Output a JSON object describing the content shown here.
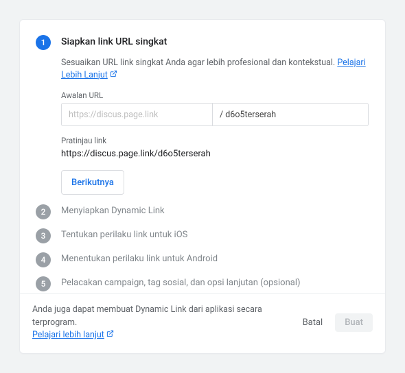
{
  "steps": {
    "s1": {
      "num": "1",
      "title": "Siapkan link URL singkat",
      "desc": "Sesuaikan URL link singkat Anda agar lebih profesional dan kontekstual.",
      "learn": "Pelajari Lebih Lanjut",
      "urlLabel": "Awalan URL",
      "urlPrefix": "https://discus.page.link",
      "urlSuffix": "/ d6o5terserah",
      "previewLabel": "Pratinjau link",
      "previewValue": "https://discus.page.link/d6o5terserah",
      "next": "Berikutnya"
    },
    "s2": {
      "num": "2",
      "title": "Menyiapkan Dynamic Link"
    },
    "s3": {
      "num": "3",
      "title": "Tentukan perilaku link untuk iOS"
    },
    "s4": {
      "num": "4",
      "title": "Menentukan perilaku link untuk Android"
    },
    "s5": {
      "num": "5",
      "title": "Pelacakan campaign, tag sosial, dan opsi lanjutan (opsional)"
    }
  },
  "footer": {
    "text": "Anda juga dapat membuat Dynamic Link dari aplikasi secara terprogram.",
    "learn": "Pelajari lebih lanjut",
    "cancel": "Batal",
    "create": "Buat"
  }
}
